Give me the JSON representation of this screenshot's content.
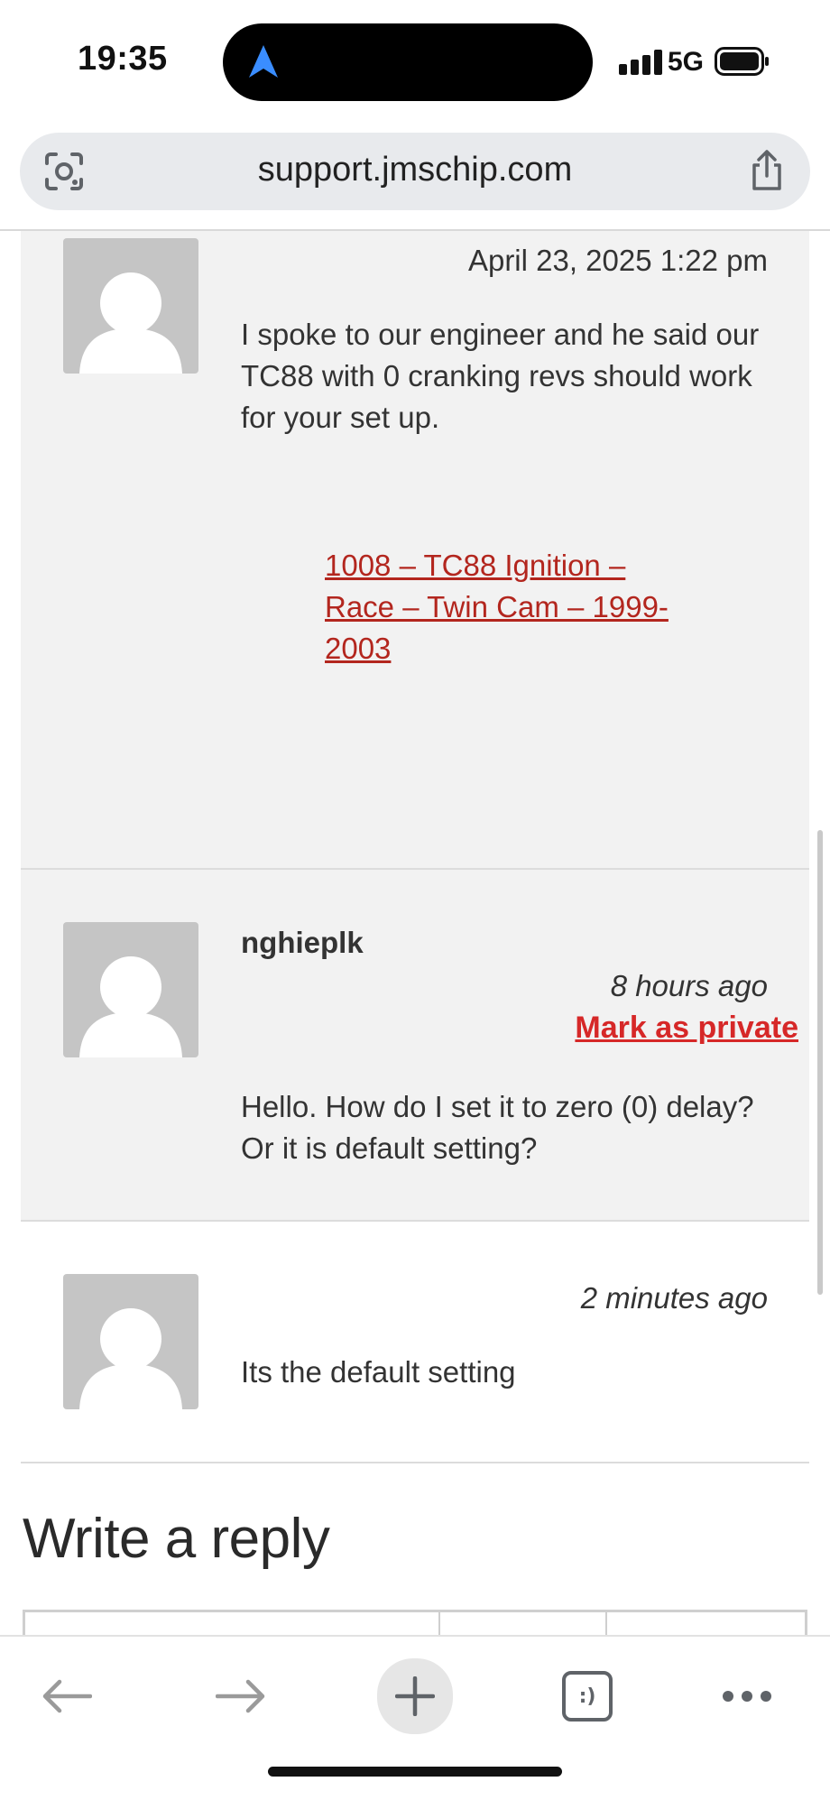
{
  "status_bar": {
    "time": "19:35",
    "network": "5G",
    "icons": [
      "location-arrow-icon",
      "signal-icon",
      "battery-icon"
    ]
  },
  "browser": {
    "url": "support.jmschip.com",
    "icons": [
      "google-lens-icon",
      "share-icon"
    ]
  },
  "comments": [
    {
      "date": "April 23, 2025 1:22 pm",
      "text": "I spoke to our engineer and he said our TC88 with 0 cranking revs should work for your set up.",
      "link_text": "1008 – TC88 Ignition – Race – Twin Cam – 1999-2003"
    },
    {
      "author": "nghieplk",
      "date": "8 hours ago",
      "private_link": "Mark as private",
      "text": "Hello. How do I set it to zero (0) delay? Or it is default setting?"
    },
    {
      "date": "2 minutes ago",
      "text": "Its the default setting"
    }
  ],
  "reply": {
    "heading": "Write a reply"
  },
  "toolbar": {
    "tabs_label": ":)",
    "icons": [
      "back-arrow-icon",
      "forward-arrow-icon",
      "new-tab-icon",
      "tab-switcher-icon",
      "more-icon"
    ]
  },
  "colors": {
    "link_red": "#b3261e",
    "private_red": "#d62828",
    "shaded_bg": "#f2f2f2",
    "url_bar_bg": "#e8eaed"
  }
}
